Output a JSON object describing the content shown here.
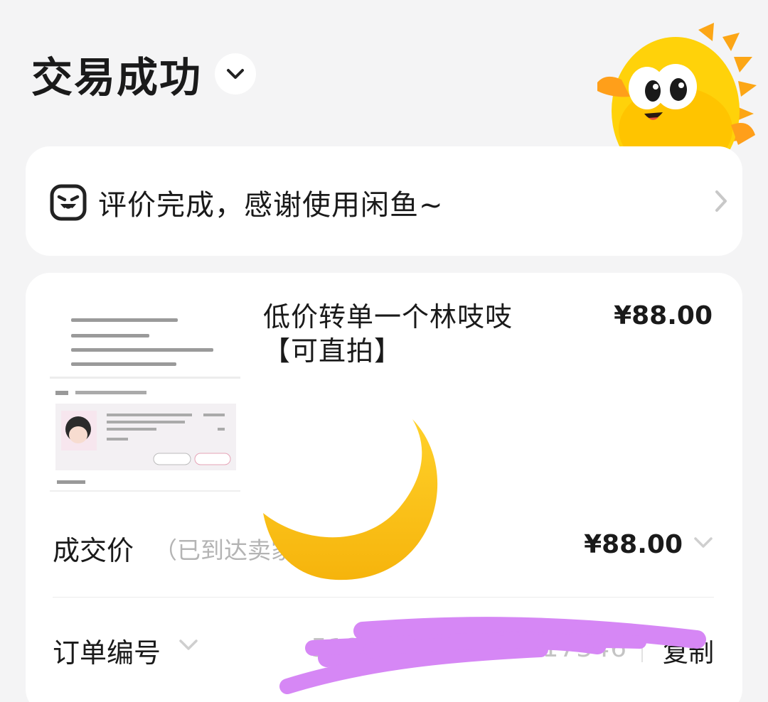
{
  "header": {
    "title": "交易成功",
    "toggle_icon": "chevron-down-icon"
  },
  "review": {
    "icon": "smiley-face-icon",
    "text": "评价完成，感谢使用闲鱼~",
    "chevron_icon": "chevron-right-icon"
  },
  "item": {
    "title": "低价转单一个林吱吱【可直拍】",
    "price": "¥88.00"
  },
  "deal_price": {
    "label": "成交价",
    "sublabel": "（已到达卖家",
    "value": "¥88.00",
    "chevron_icon": "chevron-down-icon"
  },
  "order_number": {
    "label": "订单编号",
    "value": "5127",
    "value_tail": "0290017346",
    "copy_label": "复制",
    "chevron_icon": "chevron-down-icon"
  },
  "colors": {
    "background": "#f4f4f5",
    "card": "#ffffff",
    "moon": "#fcc21b",
    "scribble": "#d687f5"
  }
}
